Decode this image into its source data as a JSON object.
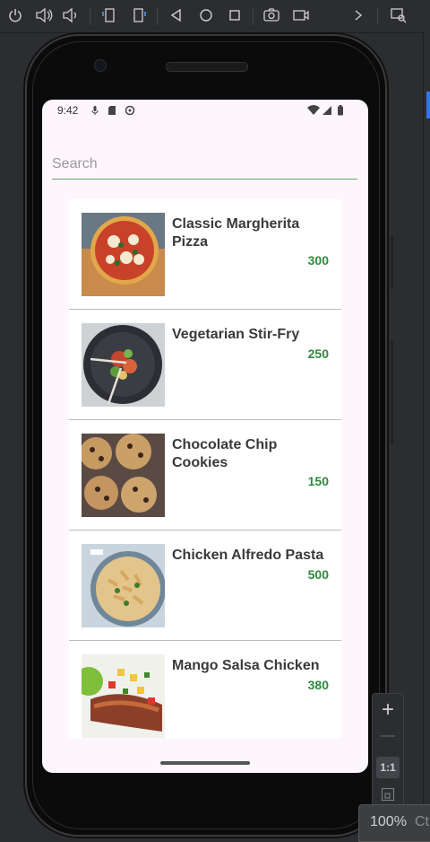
{
  "toolbar": {
    "icons": [
      "power-icon",
      "volume-up-icon",
      "volume-down-icon",
      "rotate-left-icon",
      "rotate-right-icon",
      "back-icon",
      "home-icon",
      "overview-icon",
      "camera-icon",
      "screen-record-icon",
      "more-icon",
      "snapshots-icon"
    ]
  },
  "status_bar": {
    "time": "9:42",
    "icons": [
      "mic-icon",
      "sd-card-icon",
      "sync-icon",
      "wifi-icon",
      "signal-icon",
      "battery-icon"
    ]
  },
  "search": {
    "placeholder": "Search",
    "value": ""
  },
  "recipes": [
    {
      "name": "Classic Margherita Pizza",
      "price": "300"
    },
    {
      "name": "Vegetarian Stir-Fry",
      "price": "250"
    },
    {
      "name": "Chocolate Chip Cookies",
      "price": "150"
    },
    {
      "name": "Chicken Alfredo Pasta",
      "price": "500"
    },
    {
      "name": "Mango Salsa Chicken",
      "price": "380"
    }
  ],
  "zoom": {
    "plus": "+",
    "minus": "—",
    "ratio": "1:1",
    "percent": "100%",
    "cut_label": "Ct"
  },
  "colors": {
    "price": "#2e8b3a",
    "screen_bg": "#fdf7fd",
    "search_underline": "#6aa36a",
    "ide_bg": "#2b2d30"
  }
}
